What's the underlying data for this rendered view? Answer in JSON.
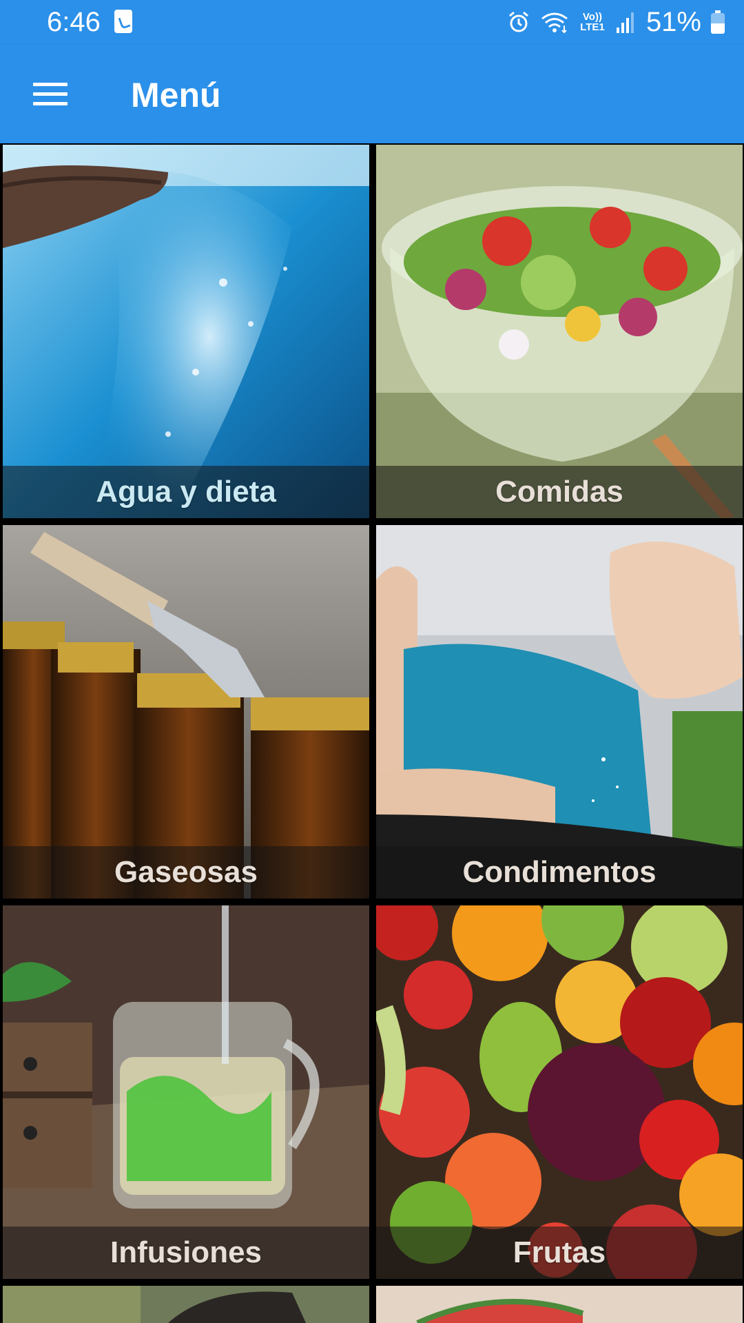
{
  "status_bar": {
    "time": "6:46",
    "network": "Vo)) LTE1",
    "battery_percent": "51%",
    "battery_level": 0.51,
    "icons": [
      "notification-icon",
      "alarm-icon",
      "wifi-icon",
      "lte-icon",
      "signal-icon",
      "battery-icon"
    ]
  },
  "app_bar": {
    "title": "Menú",
    "menu_icon": "hamburger-menu-icon"
  },
  "categories": [
    {
      "label": "Agua y dieta",
      "image": "water-splash"
    },
    {
      "label": "Comidas",
      "image": "salad-bowl"
    },
    {
      "label": "Gaseosas",
      "image": "bottles"
    },
    {
      "label": "Condimentos",
      "image": "salting-hand"
    },
    {
      "label": "Infusiones",
      "image": "herbal-tea"
    },
    {
      "label": "Frutas",
      "image": "fruits"
    },
    {
      "label": "",
      "image": "person-partial"
    },
    {
      "label": "",
      "image": "watermelon-partial"
    }
  ],
  "colors": {
    "primary": "#2b90e9",
    "label_overlay": "#141414",
    "label_text": "#e8e0d8"
  }
}
